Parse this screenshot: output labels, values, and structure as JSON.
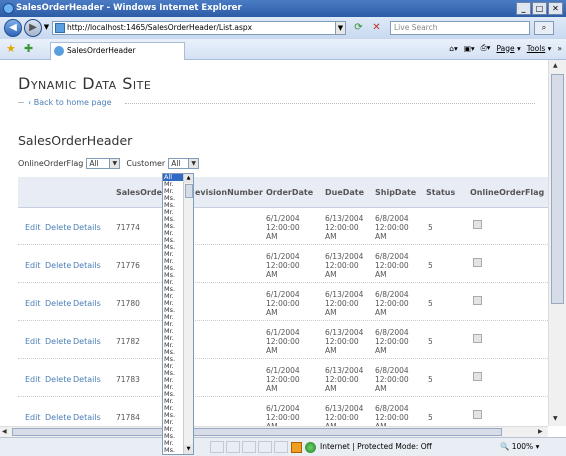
{
  "window": {
    "title": "SalesOrderHeader - Windows Internet Explorer",
    "buttons": [
      "_",
      "□",
      "✕"
    ]
  },
  "address": {
    "url": "http://localhost:1465/SalesOrderHeader/List.aspx",
    "search_placeholder": "Live Search"
  },
  "tab": {
    "title": "SalesOrderHeader"
  },
  "commands": {
    "page": "Page",
    "tools": "Tools"
  },
  "site": {
    "title": "Dynamic Data Site",
    "back_link": "Back to home page"
  },
  "page": {
    "title": "SalesOrderHeader"
  },
  "filters": {
    "online_label": "OnlineOrderFlag",
    "online_value": "All",
    "customer_label": "Customer",
    "customer_value": "All"
  },
  "table": {
    "headers": [
      "SalesOrde",
      "evisionNumber",
      "OrderDate",
      "DueDate",
      "ShipDate",
      "Status",
      "OnlineOrderFlag"
    ],
    "actions": [
      "Edit",
      "Delete",
      "Details"
    ],
    "rows": [
      {
        "id": "71774",
        "order": [
          "6/1/2004",
          "12:00:00",
          "AM"
        ],
        "due": [
          "6/13/2004",
          "12:00:00",
          "AM"
        ],
        "ship": [
          "6/8/2004",
          "12:00:00",
          "AM"
        ],
        "status": "5"
      },
      {
        "id": "71776",
        "order": [
          "6/1/2004",
          "12:00:00",
          "AM"
        ],
        "due": [
          "6/13/2004",
          "12:00:00",
          "AM"
        ],
        "ship": [
          "6/8/2004",
          "12:00:00",
          "AM"
        ],
        "status": "5"
      },
      {
        "id": "71780",
        "order": [
          "6/1/2004",
          "12:00:00",
          "AM"
        ],
        "due": [
          "6/13/2004",
          "12:00:00",
          "AM"
        ],
        "ship": [
          "6/8/2004",
          "12:00:00",
          "AM"
        ],
        "status": "5"
      },
      {
        "id": "71782",
        "order": [
          "6/1/2004",
          "12:00:00",
          "AM"
        ],
        "due": [
          "6/13/2004",
          "12:00:00",
          "AM"
        ],
        "ship": [
          "6/8/2004",
          "12:00:00",
          "AM"
        ],
        "status": "5"
      },
      {
        "id": "71783",
        "order": [
          "6/1/2004",
          "12:00:00",
          "AM"
        ],
        "due": [
          "6/13/2004",
          "12:00:00",
          "AM"
        ],
        "ship": [
          "6/8/2004",
          "12:00:00",
          "AM"
        ],
        "status": "5"
      },
      {
        "id": "71784",
        "order": [
          "6/1/2004",
          "12:00:00",
          "AM"
        ],
        "due": [
          "6/13/2004",
          "12:00:00",
          "AM"
        ],
        "ship": [
          "6/8/2004",
          "12:00:00",
          "AM"
        ],
        "status": "5"
      }
    ]
  },
  "customer_dropdown": {
    "options": [
      "All",
      "Mr.",
      "Mr.",
      "Ms.",
      "Ms.",
      "Mr.",
      "Ms.",
      "Ms.",
      "Mr.",
      "Ms.",
      "Ms.",
      "Mr.",
      "Mr.",
      "Ms.",
      "Ms.",
      "Mr.",
      "Ms.",
      "Mr.",
      "Mr.",
      "Ms.",
      "Mr.",
      "Mr.",
      "Mr.",
      "Mr.",
      "Mr.",
      "Ms.",
      "Ms.",
      "Mr.",
      "Ms.",
      "Mr.",
      "Mr.",
      "Ms.",
      "Mr.",
      "Mr.",
      "Ms.",
      "Mr.",
      "Mr.",
      "Ms.",
      "Mr.",
      "Ms."
    ]
  },
  "status": {
    "zone": "Internet | Protected Mode: Off",
    "zoom": "100%"
  }
}
